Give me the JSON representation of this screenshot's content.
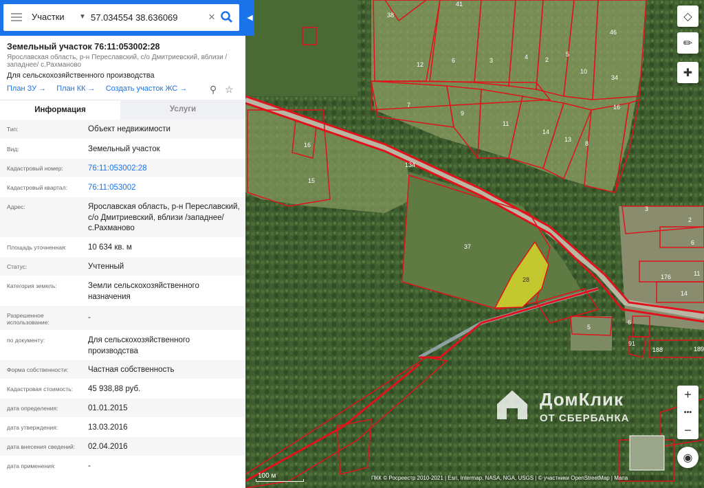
{
  "search": {
    "layer": "Участки",
    "value": "57.034554 38.636069"
  },
  "parcel": {
    "title": "Земельный участок 76:11:053002:28",
    "address_small": "Ярославская область, р-н Переславский, с/о Дмитриевский, вблизи /западнее/ с.Рахманово",
    "purpose": "Для сельскохозяйственного производства",
    "links": [
      "План ЗУ →",
      "План КК →",
      "Создать участок ЖС →"
    ]
  },
  "tabs": [
    "Информация",
    "Услуги"
  ],
  "rows": [
    {
      "label": "Тип:",
      "value": "Объект недвижимости"
    },
    {
      "label": "Вид:",
      "value": "Земельный участок"
    },
    {
      "label": "Кадастровый номер:",
      "value": "76:11:053002:28"
    },
    {
      "label": "Кадастровый квартал:",
      "value": "76:11:053002"
    },
    {
      "label": "Адрес:",
      "value": "Ярославская область, р-н Переславский, с/о Дмитриевский, вблизи /западнее/ с.Рахманово"
    },
    {
      "label": "Площадь уточненная:",
      "value": "10 634 кв. м"
    },
    {
      "label": "Статус:",
      "value": "Учтенный"
    },
    {
      "label": "Категория земель:",
      "value": "Земли сельскохозяйственного назначения"
    },
    {
      "label": "Разрешенное использование:",
      "value": "-"
    },
    {
      "label": "по документу:",
      "value": "Для сельскохозяйственного производства"
    },
    {
      "label": "Форма собственности:",
      "value": "Частная собственность"
    },
    {
      "label": "Кадастровая стоимость:",
      "value": "45 938,88 руб."
    },
    {
      "label": "дата определения:",
      "value": "01.01.2015"
    },
    {
      "label": "дата утверждения:",
      "value": "13.03.2016"
    },
    {
      "label": "дата внесения сведений:",
      "value": "02.04.2016"
    },
    {
      "label": "дата применения:",
      "value": "-"
    }
  ],
  "map": {
    "parcel_labels": [
      "38",
      "41",
      "46",
      "12",
      "6",
      "3",
      "4",
      "2",
      "5",
      "10",
      "34",
      "7",
      "9",
      "11",
      "14",
      "13",
      "8",
      "16",
      "134",
      "16",
      "15",
      "37",
      "28",
      "3",
      "2",
      "5",
      "6",
      "176",
      "11",
      "14",
      "5",
      "6",
      "91",
      "188",
      "189"
    ],
    "highlight_color": "#d4d62a",
    "boundary_color": "#e0121b",
    "scale_label": "100 м",
    "attribution": "ПКК © Росреестр 2010-2021 | Esri, Intermap, NASA, NGA, USGS | © участники OpenStreetMap | Мапа"
  },
  "watermark": {
    "line1": "ДомКлик",
    "line2": "ОТ СБЕРБАНКА"
  },
  "controls": {
    "zoom_in": "+",
    "zoom_more": "•••",
    "zoom_out": "−"
  }
}
